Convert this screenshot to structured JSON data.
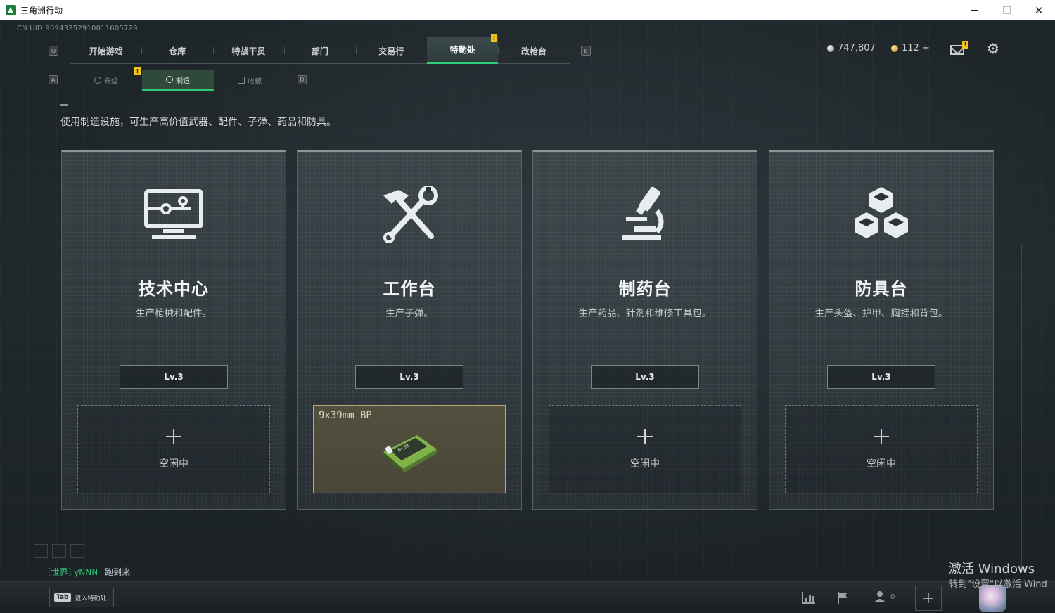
{
  "window": {
    "title": "三角洲行动",
    "min_label": "",
    "max_label": "",
    "close_label": "✕"
  },
  "uid": "CN UID:9094325291001160572​9",
  "hotkeys": {
    "q": "Q",
    "e": "E",
    "a": "A",
    "d": "D"
  },
  "top_tabs": [
    {
      "label": "开始游戏",
      "active": false
    },
    {
      "label": "仓库",
      "active": false
    },
    {
      "label": "特战干员",
      "active": false
    },
    {
      "label": "部门",
      "active": false
    },
    {
      "label": "交易行",
      "active": false
    },
    {
      "label": "特勤处",
      "active": true
    },
    {
      "label": "改枪台",
      "active": false
    }
  ],
  "badge_mark": "!",
  "currency": {
    "silver": "747,807",
    "gold": "112 +"
  },
  "sub_tabs": [
    {
      "label": "升级",
      "active": false
    },
    {
      "label": "制造",
      "active": true
    },
    {
      "label": "收藏",
      "active": false
    }
  ],
  "description": "使用制造设施，可生产高价值武器、配件、子弹、药品和防具。",
  "cards": [
    {
      "name": "技术中心",
      "desc": "生产枪械和配件。",
      "level": "Lv.3",
      "idle_label": "空闲中",
      "icon": "computer-icon"
    },
    {
      "name": "工作台",
      "desc": "生产子弹。",
      "level": "Lv.3",
      "item": "9x39mm BP",
      "icon": "hammer-wrench-icon"
    },
    {
      "name": "制药台",
      "desc": "生产药品、针剂和维修工具包。",
      "level": "Lv.3",
      "idle_label": "空闲中",
      "icon": "microscope-icon"
    },
    {
      "name": "防具台",
      "desc": "生产头盔、护甲、胸挂和背包。",
      "level": "Lv.3",
      "idle_label": "空闲中",
      "icon": "boxes-icon"
    }
  ],
  "chat": {
    "channel": "[世界]",
    "user": "yNNN",
    "message": "跑到来"
  },
  "bottom": {
    "tab_key": "Tab",
    "tab_label": "进入特勤处",
    "friends_count": "0"
  },
  "watermark": {
    "line1": "激活 Windows",
    "line2": "转到\"设置\"以激活 Wind"
  },
  "colors": {
    "accent_green": "#29d07a",
    "badge_yellow": "#f2c21b"
  }
}
